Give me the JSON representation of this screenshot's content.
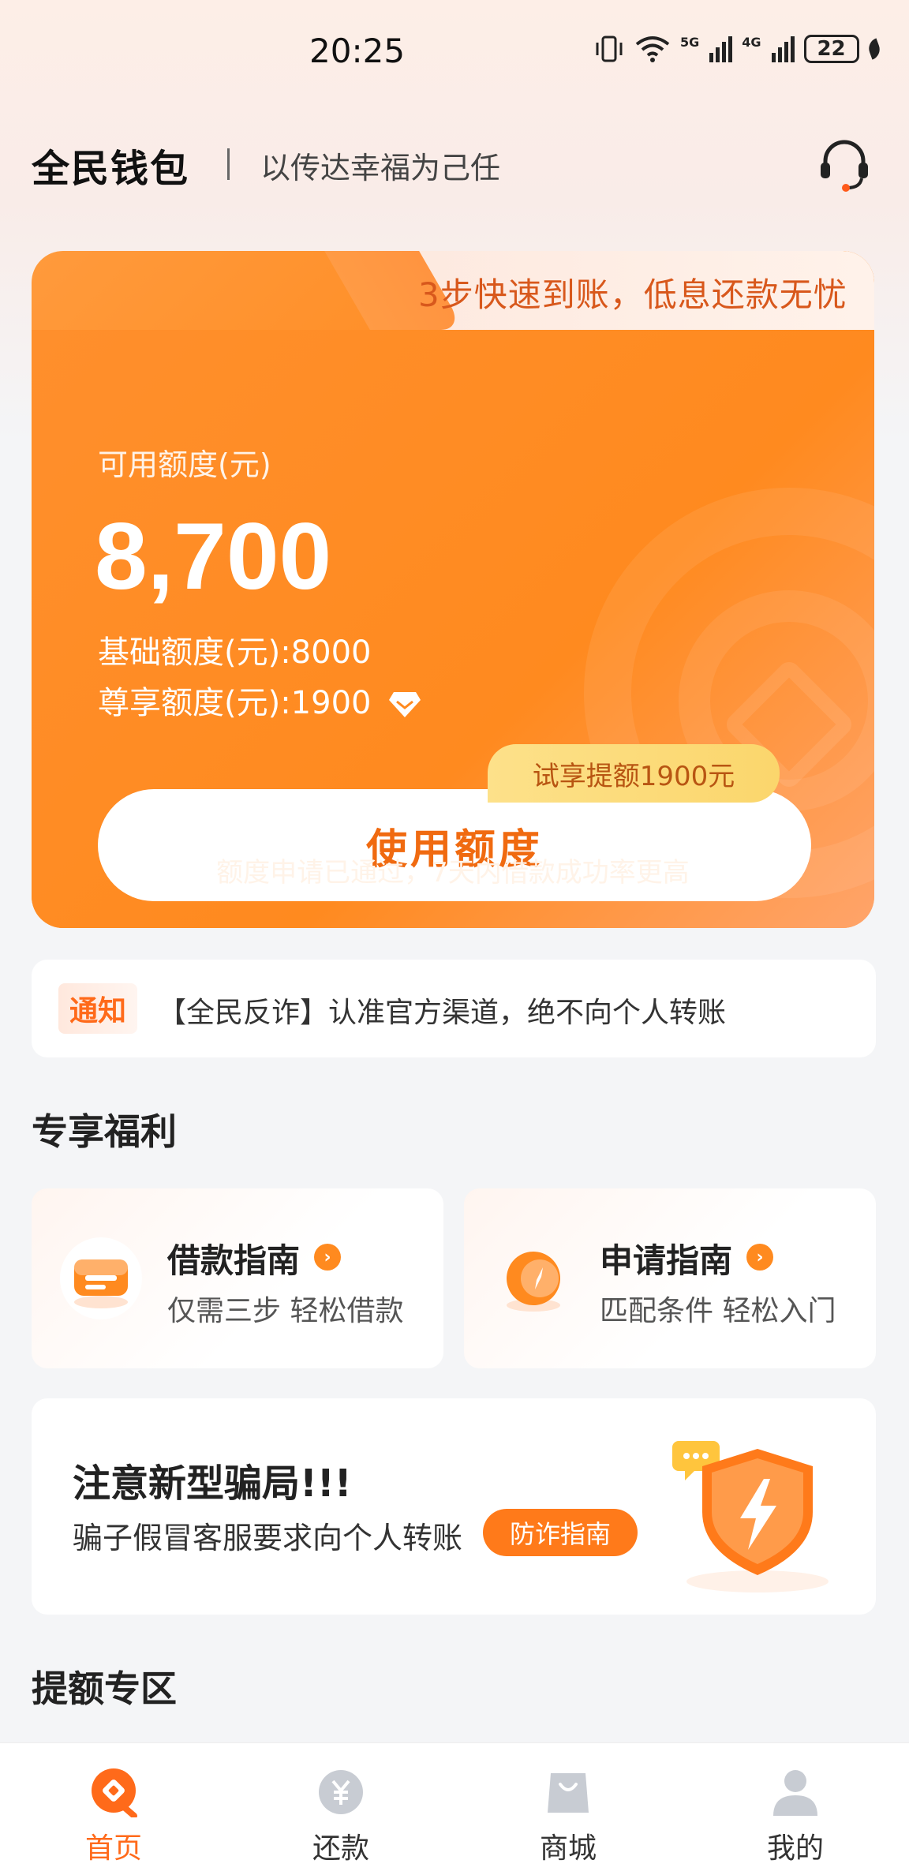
{
  "status_bar": {
    "time": "20:25",
    "signal_5g": "5G",
    "signal_4g": "4G",
    "battery": "22"
  },
  "header": {
    "brand": "全民钱包",
    "slogan": "以传达幸福为己任"
  },
  "credit_card": {
    "tab_text": "3步快速到账，低息还款无忧",
    "available_label": "可用额度(元)",
    "available_amount": "8,700",
    "base_limit": "基础额度(元):8000",
    "vip_limit": "尊享额度(元):1900",
    "trial_badge": "试享提额1900元",
    "use_button": "使用额度",
    "approval_text": "额度申请已通过，7天内借款成功率更高"
  },
  "notice": {
    "tag": "通知",
    "text": "【全民反诈】认准官方渠道，绝不向个人转账"
  },
  "benefits": {
    "title": "专享福利",
    "cards": [
      {
        "title": "借款指南",
        "subtitle": "仅需三步 轻松借款",
        "icon": "loan-guide-icon"
      },
      {
        "title": "申请指南",
        "subtitle": "匹配条件 轻松入门",
        "icon": "compass-icon"
      }
    ]
  },
  "fraud_card": {
    "title": "注意新型骗局!!!",
    "desc": "骗子假冒客服要求向个人转账",
    "button": "防诈指南"
  },
  "limit_zone": {
    "title": "提额专区"
  },
  "bottom_nav": {
    "items": [
      {
        "label": "首页",
        "icon": "home-icon",
        "active": true
      },
      {
        "label": "还款",
        "icon": "yuan-coin-icon",
        "active": false
      },
      {
        "label": "商城",
        "icon": "shopping-bag-icon",
        "active": false
      },
      {
        "label": "我的",
        "icon": "user-icon",
        "active": false
      }
    ]
  },
  "colors": {
    "brand_orange": "#ff8a1f",
    "accent_text": "#f06a10",
    "background": "#f4f5f7"
  }
}
